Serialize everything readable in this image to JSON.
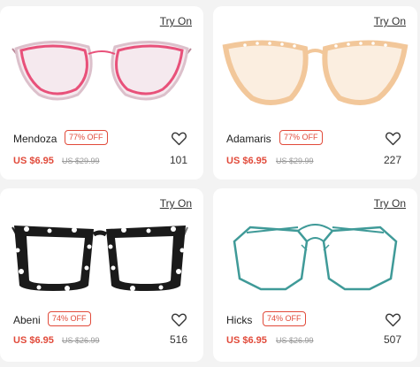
{
  "products": [
    {
      "try_on": "Try On",
      "name": "Mendoza",
      "discount": "77% OFF",
      "price": "US $6.95",
      "old_price": "US $29.99",
      "count": "101",
      "frame_color": "#e8517a",
      "favorite_icon": "heart-icon"
    },
    {
      "try_on": "Try On",
      "name": "Adamaris",
      "discount": "77% OFF",
      "price": "US $6.95",
      "old_price": "US $29.99",
      "count": "227",
      "frame_color": "#f2c79a",
      "favorite_icon": "heart-icon"
    },
    {
      "try_on": "Try On",
      "name": "Abeni",
      "discount": "74% OFF",
      "price": "US $6.95",
      "old_price": "US $26.99",
      "count": "516",
      "frame_color": "#1a1a1a",
      "favorite_icon": "heart-icon"
    },
    {
      "try_on": "Try On",
      "name": "Hicks",
      "discount": "74% OFF",
      "price": "US $6.95",
      "old_price": "US $26.99",
      "count": "507",
      "frame_color": "#3f9a98",
      "favorite_icon": "heart-icon"
    }
  ]
}
